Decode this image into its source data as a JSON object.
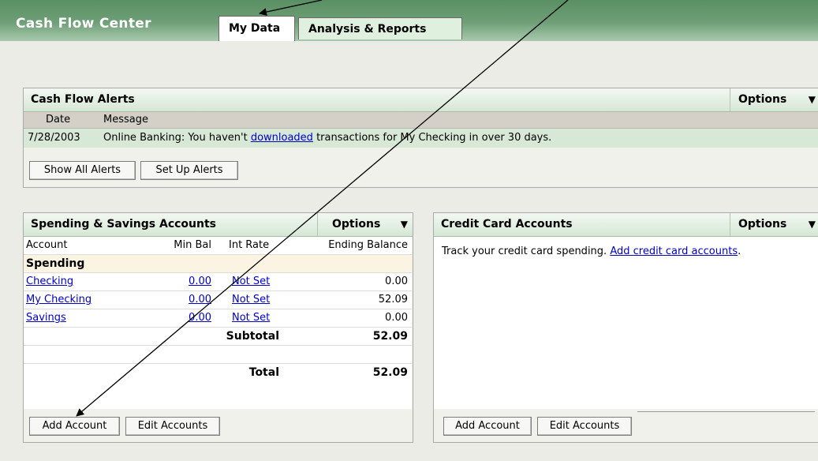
{
  "app": {
    "title": "Cash Flow Center"
  },
  "tabs": [
    {
      "label": "My Data"
    },
    {
      "label": "Analysis & Reports"
    }
  ],
  "alerts": {
    "title": "Cash Flow Alerts",
    "options_label": "Options",
    "columns": [
      "Date",
      "Message"
    ],
    "rows": [
      {
        "date": "7/28/2003",
        "prefix": "Online Banking: You haven't ",
        "link": "downloaded",
        "suffix": " transactions for My Checking in over 30 days."
      }
    ],
    "buttons": [
      "Show All Alerts",
      "Set Up Alerts"
    ]
  },
  "spending": {
    "title": "Spending & Savings Accounts",
    "options_label": "Options",
    "columns": [
      "Account",
      "Min Bal",
      "Int Rate",
      "Ending Balance"
    ],
    "group_label": "Spending",
    "accounts": [
      {
        "name": "Checking",
        "min_bal": "0.00",
        "int_rate": "Not Set",
        "balance": "0.00"
      },
      {
        "name": "My Checking",
        "min_bal": "0.00",
        "int_rate": "Not Set",
        "balance": "52.09"
      },
      {
        "name": "Savings",
        "min_bal": "0.00",
        "int_rate": "Not Set",
        "balance": "0.00"
      }
    ],
    "subtotal_label": "Subtotal",
    "subtotal_value": "52.09",
    "total_label": "Total",
    "total_value": "52.09",
    "buttons": [
      "Add Account",
      "Edit Accounts"
    ]
  },
  "credit": {
    "title": "Credit Card Accounts",
    "options_label": "Options",
    "message": "Track your credit card spending. ",
    "link": "Add credit card accounts",
    "message_end": ".",
    "buttons": [
      "Add Account",
      "Edit Accounts"
    ]
  },
  "colors": {
    "header_green": "#5a8f63",
    "panel_header": "#d5e7d4",
    "link": "#0000cc",
    "arrow": "#000000"
  }
}
